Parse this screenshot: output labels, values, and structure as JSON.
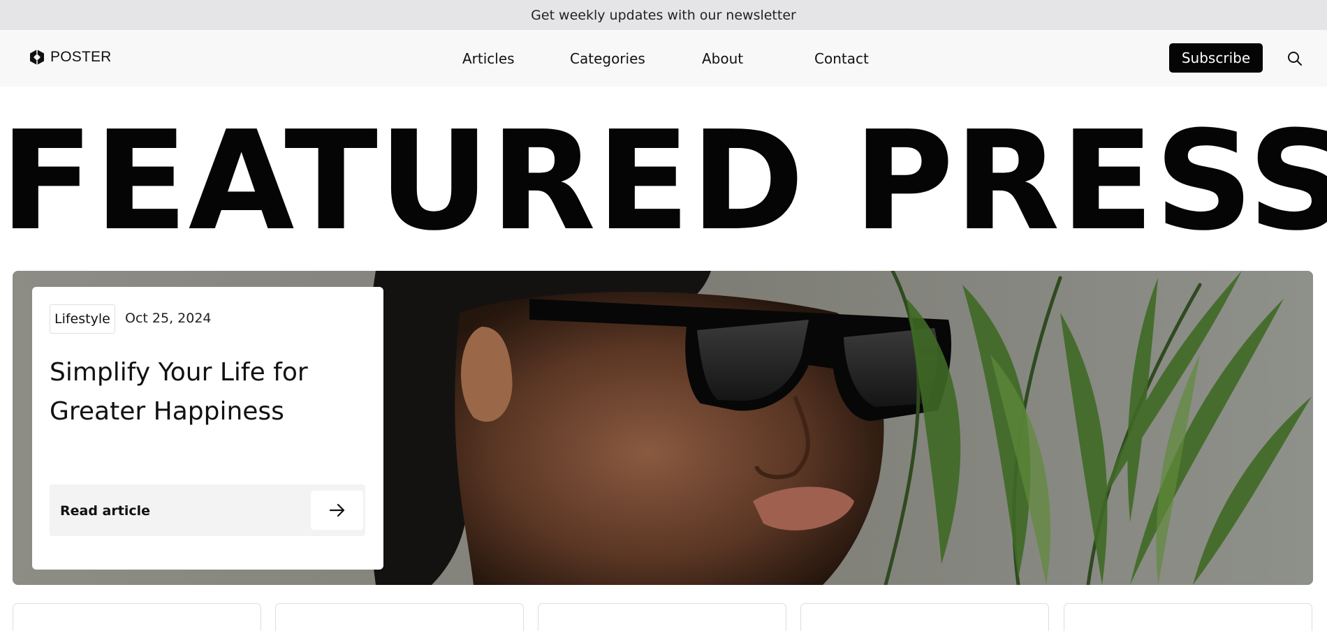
{
  "newsletter_bar": {
    "text": "Get weekly updates with our newsletter"
  },
  "brand": {
    "name": "POSTER",
    "icon": "hexagon-logo-icon"
  },
  "nav": {
    "items": [
      {
        "label": "Articles"
      },
      {
        "label": "Categories"
      },
      {
        "label": "About"
      },
      {
        "label": "Contact"
      }
    ],
    "subscribe_label": "Subscribe",
    "search_icon": "search-icon"
  },
  "hero": {
    "title": "FEATURED PRESS",
    "image": "portrait-sunglasses-palm-leaves",
    "article": {
      "category": "Lifestyle",
      "date": "Oct 25, 2024",
      "title": "Simplify Your Life for Greater Happiness",
      "read_label": "Read article",
      "read_icon": "arrow-right-icon"
    }
  },
  "article_cards_row": {
    "count": 5
  },
  "colors": {
    "topbar_bg": "#e5e5e7",
    "navbar_bg": "#f8f8f8",
    "button_bg": "#050505",
    "read_bar_bg": "#f3f3f3"
  }
}
